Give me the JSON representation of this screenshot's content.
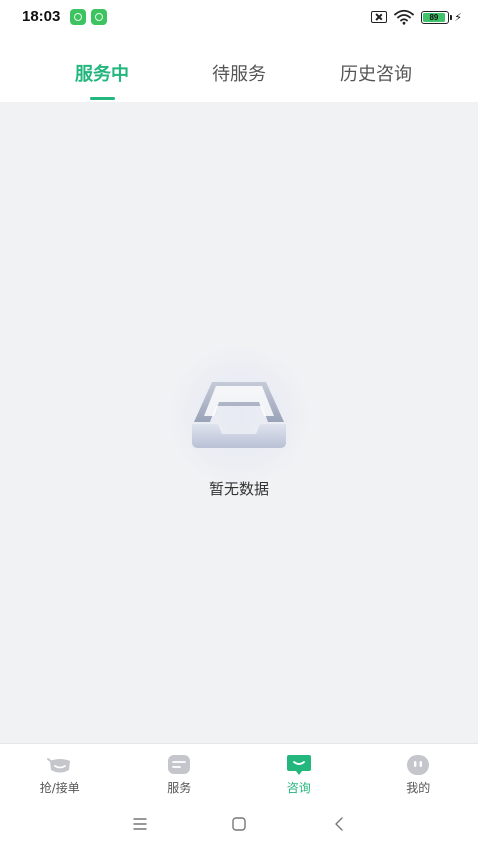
{
  "status_bar": {
    "time": "18:03",
    "battery_level": "89",
    "battery_percent": 89
  },
  "tabs": [
    {
      "label": "服务中",
      "active": true
    },
    {
      "label": "待服务",
      "active": false
    },
    {
      "label": "历史咨询",
      "active": false
    }
  ],
  "content": {
    "empty_text": "暂无数据",
    "empty_icon": "empty-box-icon"
  },
  "bottom_nav": [
    {
      "label": "抢/接单",
      "icon": "grab-order-icon",
      "active": false
    },
    {
      "label": "服务",
      "icon": "service-icon",
      "active": false
    },
    {
      "label": "咨询",
      "icon": "consult-icon",
      "active": true
    },
    {
      "label": "我的",
      "icon": "profile-icon",
      "active": false
    }
  ],
  "colors": {
    "accent": "#23b67d",
    "background": "#f1f2f4",
    "inactive_icon": "#c4c6cc"
  }
}
